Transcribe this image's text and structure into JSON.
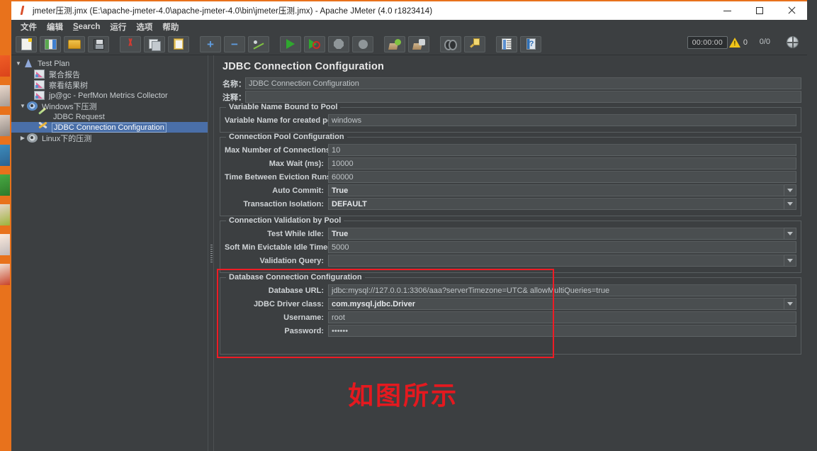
{
  "window": {
    "title": "jmeter压测.jmx (E:\\apache-jmeter-4.0\\apache-jmeter-4.0\\bin\\jmeter压测.jmx) - Apache JMeter (4.0 r1823414)",
    "minimize_label": "Minimize",
    "maximize_label": "Maximize",
    "close_label": "Close"
  },
  "menubar": {
    "items": [
      {
        "label": "文件"
      },
      {
        "label": "编辑"
      },
      {
        "label_prefix": "S",
        "label_rest": "earch"
      },
      {
        "label": "运行"
      },
      {
        "label": "选项"
      },
      {
        "label": "帮助"
      }
    ]
  },
  "toolbar": {
    "buttons": [
      {
        "name": "new",
        "title": "New"
      },
      {
        "name": "templates",
        "title": "Templates"
      },
      {
        "name": "open",
        "title": "Open"
      },
      {
        "name": "save",
        "title": "Save"
      },
      {
        "name": "cut",
        "title": "Cut"
      },
      {
        "name": "copy",
        "title": "Copy"
      },
      {
        "name": "paste",
        "title": "Paste"
      },
      {
        "name": "expand",
        "title": "Expand All"
      },
      {
        "name": "collapse",
        "title": "Collapse All"
      },
      {
        "name": "toggle",
        "title": "Toggle"
      },
      {
        "name": "start",
        "title": "Start"
      },
      {
        "name": "start-no-pause",
        "title": "Start no pauses"
      },
      {
        "name": "stop",
        "title": "Stop"
      },
      {
        "name": "shutdown",
        "title": "Shutdown"
      },
      {
        "name": "clear",
        "title": "Clear"
      },
      {
        "name": "clear-all",
        "title": "Clear All"
      },
      {
        "name": "search",
        "title": "Search"
      },
      {
        "name": "reset-search",
        "title": "Reset Search"
      },
      {
        "name": "function-helper",
        "title": "Function Helper Dialog"
      },
      {
        "name": "help",
        "title": "Help"
      }
    ],
    "timer": "00:00:00",
    "warning_count": "0",
    "thread_counter": "0/0"
  },
  "tree": {
    "nodes": [
      {
        "label": "Test Plan",
        "icon": "test-plan-icon",
        "depth": 0,
        "twist": "▼",
        "selected": false
      },
      {
        "label": "聚合报告",
        "icon": "report-icon",
        "depth": 1,
        "twist": "",
        "selected": false
      },
      {
        "label": "察看结果树",
        "icon": "report-icon",
        "depth": 1,
        "twist": "",
        "selected": false
      },
      {
        "label": "jp@gc - PerfMon Metrics Collector",
        "icon": "report-icon",
        "depth": 1,
        "twist": "",
        "selected": false
      },
      {
        "label": "Windows下压测",
        "icon": "thread-group-icon",
        "depth": 1,
        "twist": "▼",
        "selected": false
      },
      {
        "label": "JDBC Request",
        "icon": "jdbc-request-icon",
        "depth": 2,
        "twist": "",
        "selected": false
      },
      {
        "label": "JDBC Connection Configuration",
        "icon": "config-element-icon",
        "depth": 2,
        "twist": "",
        "selected": true
      },
      {
        "label": "Linux下的压测",
        "icon": "thread-group-icon",
        "depth": 1,
        "twist": "▶",
        "selected": false
      }
    ]
  },
  "config": {
    "panel_title": "JDBC Connection Configuration",
    "name_label": "名称：",
    "name_value": "JDBC Connection Configuration",
    "comment_label": "注释：",
    "comment_value": "",
    "groups": [
      {
        "title": "Variable Name Bound to Pool",
        "rows": [
          {
            "label": "Variable Name for created pool:",
            "value": "windows",
            "type": "text"
          }
        ]
      },
      {
        "title": "Connection Pool Configuration",
        "rows": [
          {
            "label": "Max Number of Connections:",
            "value": "10",
            "type": "text"
          },
          {
            "label": "Max Wait (ms):",
            "value": "10000",
            "type": "text"
          },
          {
            "label": "Time Between Eviction Runs (ms):",
            "value": "60000",
            "type": "text"
          },
          {
            "label": "Auto Commit:",
            "value": "True",
            "type": "combo"
          },
          {
            "label": "Transaction Isolation:",
            "value": "DEFAULT",
            "type": "combo"
          }
        ]
      },
      {
        "title": "Connection Validation by Pool",
        "rows": [
          {
            "label": "Test While Idle:",
            "value": "True",
            "type": "combo"
          },
          {
            "label": "Soft Min Evictable Idle Time(ms):",
            "value": "5000",
            "type": "text"
          },
          {
            "label": "Validation Query:",
            "value": "",
            "type": "combo"
          }
        ]
      },
      {
        "title": "Database Connection Configuration",
        "highlighted": true,
        "rows": [
          {
            "label": "Database URL:",
            "value": "jdbc:mysql://127.0.0.1:3306/aaa?serverTimezone=UTC& allowMultiQueries=true",
            "type": "text"
          },
          {
            "label": "JDBC Driver class:",
            "value": "com.mysql.jdbc.Driver",
            "type": "combo"
          },
          {
            "label": "Username:",
            "value": "root",
            "type": "text"
          },
          {
            "label": "Password:",
            "value": "••••••",
            "type": "text"
          }
        ]
      }
    ]
  },
  "annotation": {
    "text": "如图所示",
    "color": "#e4191f"
  },
  "colors": {
    "background": "#3c3f41",
    "field": "#4a4e50",
    "selection": "#4a6fa8",
    "accent_orange": "#e8721c",
    "annotation_red": "#ee1c25"
  }
}
